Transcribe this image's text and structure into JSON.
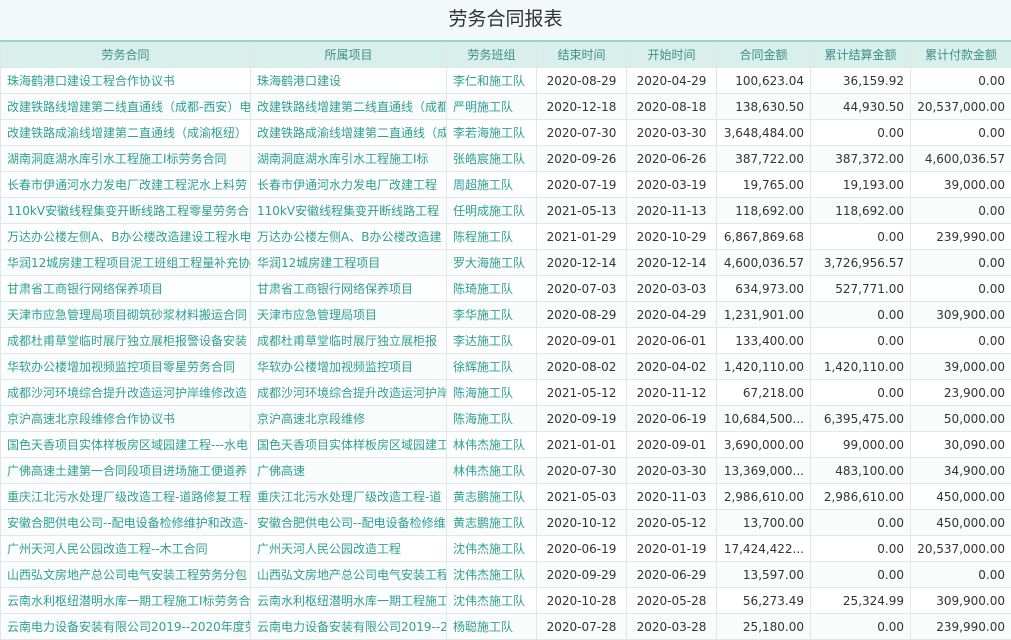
{
  "title": "劳务合同报表",
  "columns": [
    "劳务合同",
    "所属项目",
    "劳务班组",
    "结束时间",
    "开始时间",
    "合同金额",
    "累计结算金额",
    "累计付款金额"
  ],
  "rows": [
    [
      "珠海鹤港口建设工程合作协议书",
      "珠海鹤港口建设",
      "李仁和施工队",
      "2020-08-29",
      "2020-04-29",
      "100,623.04",
      "36,159.92",
      "0.00"
    ],
    [
      "改建铁路线增建第二线直通线（成都-西安）电",
      "改建铁路线增建第二线直通线（成都",
      "严明施工队",
      "2020-12-18",
      "2020-08-18",
      "138,630.50",
      "44,930.50",
      "20,537,000.00"
    ],
    [
      "改建铁路成渝线增建第二直通线（成渝枢纽）",
      "改建铁路成渝线增建第二直通线（成",
      "李若海施工队",
      "2020-07-30",
      "2020-03-30",
      "3,648,484.00",
      "0.00",
      "0.00"
    ],
    [
      "湖南洞庭湖水库引水工程施工I标劳务合同",
      "湖南洞庭湖水库引水工程施工I标",
      "张皓宸施工队",
      "2020-09-26",
      "2020-06-26",
      "387,722.00",
      "387,372.00",
      "4,600,036.57"
    ],
    [
      "长春市伊通河水力发电厂改建工程泥水上料劳",
      "长春市伊通河水力发电厂改建工程",
      "周超施工队",
      "2020-07-19",
      "2020-03-19",
      "19,765.00",
      "19,193.00",
      "39,000.00"
    ],
    [
      "110kV安徽线程集变开断线路工程零星劳务合",
      "110kV安徽线程集变开断线路工程",
      "任明成施工队",
      "2021-05-13",
      "2020-11-13",
      "118,692.00",
      "118,692.00",
      "0.00"
    ],
    [
      "万达办公楼左侧A、B办公楼改造建设工程水电",
      "万达办公楼左侧A、B办公楼改造建",
      "陈程施工队",
      "2021-01-29",
      "2020-10-29",
      "6,867,869.68",
      "0.00",
      "239,990.00"
    ],
    [
      "华润12城房建工程项目泥工班组工程量补充协",
      "华润12城房建工程项目",
      "罗大海施工队",
      "2020-12-14",
      "2020-12-14",
      "4,600,036.57",
      "3,726,956.57",
      "0.00"
    ],
    [
      "甘肃省工商银行网络保养项目",
      "甘肃省工商银行网络保养项目",
      "陈琦施工队",
      "2020-07-03",
      "2020-03-03",
      "634,973.00",
      "527,771.00",
      "0.00"
    ],
    [
      "天津市应急管理局项目砌筑砂浆材料搬运合同",
      "天津市应急管理局项目",
      "李华施工队",
      "2020-08-29",
      "2020-04-29",
      "1,231,901.00",
      "0.00",
      "309,900.00"
    ],
    [
      "成都杜甫草堂临时展厅独立展柜报警设备安装",
      "成都杜甫草堂临时展厅独立展柜报",
      "李达施工队",
      "2020-09-01",
      "2020-06-01",
      "133,400.00",
      "0.00",
      "0.00"
    ],
    [
      "华软办公楼增加视频监控项目零星劳务合同",
      "华软办公楼增加视频监控项目",
      "徐辉施工队",
      "2020-08-02",
      "2020-04-02",
      "1,420,110.00",
      "1,420,110.00",
      "39,000.00"
    ],
    [
      "成都沙河环境综合提升改造运河护岸维修改造",
      "成都沙河环境综合提升改造运河护岸",
      "陈海施工队",
      "2021-05-12",
      "2020-11-12",
      "67,218.00",
      "0.00",
      "23,900.00"
    ],
    [
      "京沪高速北京段维修合作协议书",
      "京沪高速北京段维修",
      "陈海施工队",
      "2020-09-19",
      "2020-06-19",
      "10,684,500...",
      "6,395,475.00",
      "50,000.00"
    ],
    [
      "国色天香项目实体样板房区域园建工程---水电",
      "国色天香项目实体样板房区域园建工",
      "林伟杰施工队",
      "2021-01-01",
      "2020-09-01",
      "3,690,000.00",
      "99,000.00",
      "30,090.00"
    ],
    [
      "广佛高速土建第一合同段项目进场施工便道养",
      "广佛高速",
      "林伟杰施工队",
      "2020-07-30",
      "2020-03-30",
      "13,369,000...",
      "483,100.00",
      "34,900.00"
    ],
    [
      "重庆江北污水处理厂级改造工程-道路修复工程",
      "重庆江北污水处理厂级改造工程-道",
      "黄志鹏施工队",
      "2021-05-03",
      "2020-11-03",
      "2,986,610.00",
      "2,986,610.00",
      "450,000.00"
    ],
    [
      "安徽合肥供电公司--配电设备检修维护和改造-",
      "安徽合肥供电公司--配电设备检修维",
      "黄志鹏施工队",
      "2020-10-12",
      "2020-05-12",
      "13,700.00",
      "0.00",
      "450,000.00"
    ],
    [
      "广州天河人民公园改造工程--木工合同",
      "广州天河人民公园改造工程",
      "沈伟杰施工队",
      "2020-06-19",
      "2020-01-19",
      "17,424,422...",
      "0.00",
      "20,537,000.00"
    ],
    [
      "山西弘文房地产总公司电气安装工程劳务分包",
      "山西弘文房地产总公司电气安装工程",
      "沈伟杰施工队",
      "2020-09-29",
      "2020-06-29",
      "13,597.00",
      "0.00",
      "0.00"
    ],
    [
      "云南水利枢纽潜明水库一期工程施工I标劳务合",
      "云南水利枢纽潜明水库一期工程施工",
      "沈伟杰施工队",
      "2020-10-28",
      "2020-05-28",
      "56,273.49",
      "25,324.99",
      "309,900.00"
    ],
    [
      "云南电力设备安装有限公司2019--2020年度劳",
      "云南电力设备安装有限公司2019--2",
      "杨聪施工队",
      "2020-07-28",
      "2020-03-28",
      "25,180.00",
      "0.00",
      "239,990.00"
    ]
  ]
}
